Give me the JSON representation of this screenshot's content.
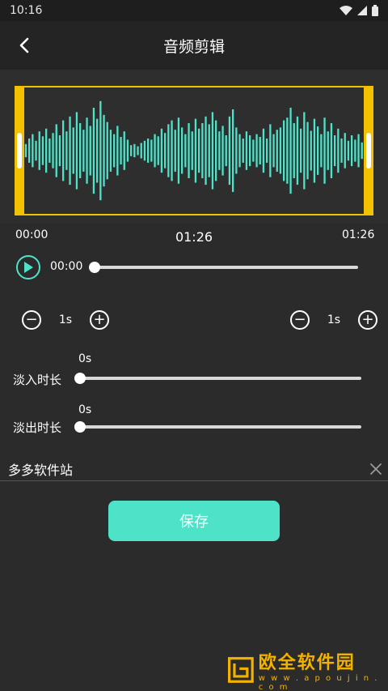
{
  "status": {
    "time": "10:16"
  },
  "header": {
    "title": "音频剪辑"
  },
  "timeline": {
    "start": "00:00",
    "current": "01:26",
    "end": "01:26"
  },
  "player": {
    "time": "00:00",
    "progress": 0
  },
  "start_stepper": {
    "value": "1s"
  },
  "end_stepper": {
    "value": "1s"
  },
  "fade_in": {
    "label": "淡入时长",
    "value": "0s",
    "level": 0
  },
  "fade_out": {
    "label": "淡出时长",
    "value": "0s",
    "level": 0
  },
  "name_field": {
    "value": "多多软件站"
  },
  "save_label": "保存",
  "watermark": {
    "text": "欧全软件园",
    "url": "w w w . a p o u j i n . c o m"
  },
  "colors": {
    "accent": "#4ee3c9",
    "trim": "#f2c200",
    "bg": "#2b2b2b"
  },
  "icons": {
    "back": "chevron-left-icon",
    "play": "play-icon",
    "minus": "minus-icon",
    "plus": "plus-icon",
    "clear": "close-icon",
    "wifi": "wifi-icon",
    "signal": "signal-icon",
    "battery": "battery-icon"
  },
  "waveform": {
    "amplitudes": [
      0.12,
      0.22,
      0.3,
      0.18,
      0.35,
      0.26,
      0.4,
      0.22,
      0.32,
      0.48,
      0.28,
      0.55,
      0.35,
      0.62,
      0.42,
      0.7,
      0.5,
      0.38,
      0.6,
      0.45,
      0.78,
      0.58,
      0.9,
      0.65,
      0.52,
      0.38,
      0.3,
      0.45,
      0.25,
      0.35,
      0.2,
      0.1,
      0.12,
      0.08,
      0.14,
      0.18,
      0.22,
      0.2,
      0.3,
      0.26,
      0.4,
      0.32,
      0.48,
      0.55,
      0.38,
      0.6,
      0.42,
      0.3,
      0.5,
      0.35,
      0.58,
      0.4,
      0.5,
      0.62,
      0.48,
      0.7,
      0.55,
      0.35,
      0.45,
      0.28,
      0.62,
      0.75,
      0.42,
      0.3,
      0.22,
      0.35,
      0.28,
      0.2,
      0.3,
      0.25,
      0.4,
      0.22,
      0.48,
      0.3,
      0.38,
      0.42,
      0.55,
      0.6,
      0.78,
      0.5,
      0.62,
      0.4,
      0.7,
      0.52,
      0.36,
      0.58,
      0.44,
      0.3,
      0.6,
      0.35,
      0.5,
      0.28,
      0.4,
      0.22,
      0.32,
      0.18,
      0.28,
      0.2,
      0.3,
      0.15
    ]
  }
}
